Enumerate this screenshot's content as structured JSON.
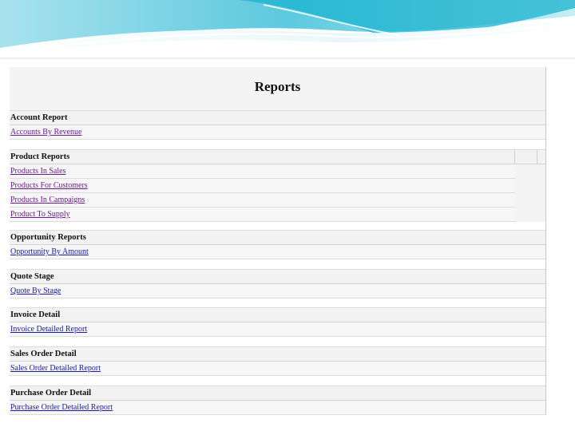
{
  "theme": {
    "wave_dark": "#1bb3cf",
    "wave_light": "#a9e2ee",
    "link_color": "#1a1aa6",
    "visited_link_color": "#6a1b8f"
  },
  "page": {
    "title": "Reports"
  },
  "sections": [
    {
      "header": "Account Report",
      "links": [
        "Accounts By Revenue"
      ]
    },
    {
      "header": "Product Reports",
      "links": [
        "Products In Sales",
        "Products For Customers",
        "Products In Campaigns",
        "Product To Supply"
      ]
    },
    {
      "header": "Opportunity Reports",
      "links": [
        "Opportunity By Amount"
      ]
    },
    {
      "header": "Quote Stage",
      "links": [
        "Quote By Stage"
      ]
    },
    {
      "header": "Invoice Detail",
      "links": [
        "Invoice Detailed Report"
      ]
    },
    {
      "header": "Sales Order Detail",
      "links": [
        "Sales Order Detailed Report"
      ]
    },
    {
      "header": "Purchase Order Detail",
      "links": [
        "Purchase Order Detailed Report"
      ]
    }
  ]
}
